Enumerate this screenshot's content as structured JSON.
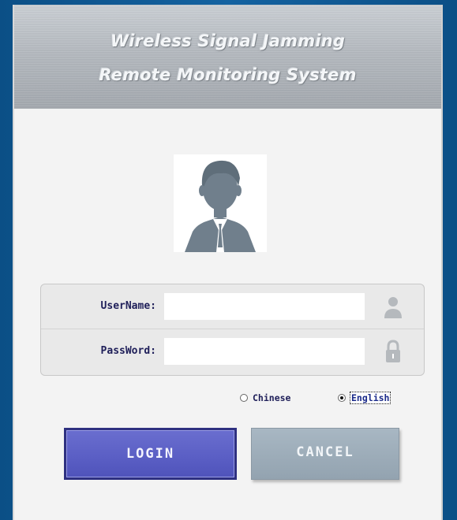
{
  "window": {
    "title_line1": "Wireless Signal Jamming",
    "title_line2": "Remote Monitoring System"
  },
  "form": {
    "username_label": "UserName:",
    "username_value": "",
    "password_label": "PassWord:",
    "password_value": ""
  },
  "language": {
    "options": [
      "Chinese",
      "English"
    ],
    "selected": "English"
  },
  "buttons": {
    "login": "LOGIN",
    "cancel": "CANCEL"
  },
  "colors": {
    "accent_login": "#5a5ec4",
    "cancel_button": "#9aaab7",
    "label_text": "#20205a",
    "icon_gray": "#707f8c"
  },
  "icons": [
    "user-avatar-icon",
    "user-icon",
    "lock-icon"
  ]
}
